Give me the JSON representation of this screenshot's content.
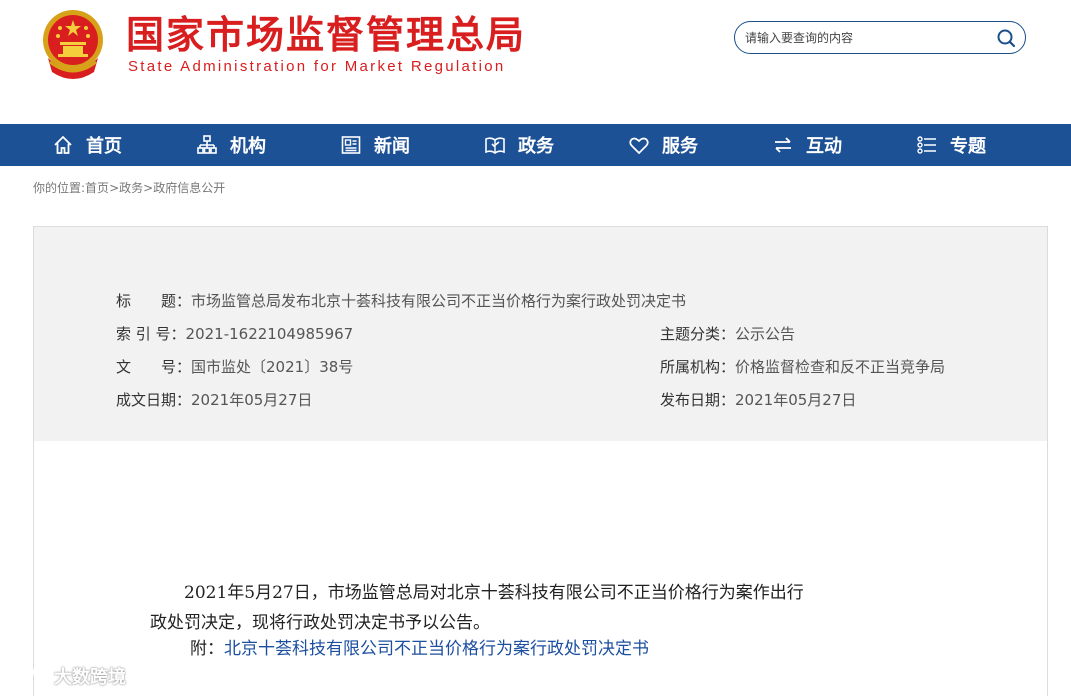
{
  "header": {
    "title": "国家市场监督管理总局",
    "subtitle": "State Administration for Market Regulation",
    "search_placeholder": "请输入要查询的内容"
  },
  "nav": {
    "items": [
      {
        "label": "首页",
        "icon": "home-icon"
      },
      {
        "label": "机构",
        "icon": "org-icon"
      },
      {
        "label": "新闻",
        "icon": "news-icon"
      },
      {
        "label": "政务",
        "icon": "affairs-icon"
      },
      {
        "label": "服务",
        "icon": "heart-icon"
      },
      {
        "label": "互动",
        "icon": "exchange-icon"
      },
      {
        "label": "专题",
        "icon": "topic-icon"
      }
    ]
  },
  "breadcrumb": {
    "prefix": "你的位置:",
    "items": [
      "首页",
      "政务",
      "政府信息公开"
    ],
    "separator": ">"
  },
  "info": {
    "title_label": "标　　题：",
    "title_value": "市场监管总局发布北京十荟科技有限公司不正当价格行为案行政处罚决定书",
    "index_label": "索 引 号：",
    "index_value": "2021-1622104985967",
    "topic_label": "主题分类：",
    "topic_value": "公示公告",
    "docno_label": "文　　号：",
    "docno_value": "国市监处〔2021〕38号",
    "org_label": "所属机构：",
    "org_value": "价格监督检查和反不正当竞争局",
    "created_label": "成文日期：",
    "created_value": "2021年05月27日",
    "published_label": "发布日期：",
    "published_value": "2021年05月27日"
  },
  "content": {
    "para_line1": "　　2021年5月27日，市场监管总局对北京十荟科技有限公司不正当价格行为案作出行",
    "para_line2": "政处罚决定，现将行政处罚决定书予以公告。",
    "attach_prefix": "附：",
    "attach_link": "北京十荟科技有限公司不正当价格行为案行政处罚决定书"
  },
  "watermark": {
    "text": "大数跨境"
  },
  "colors": {
    "brand_red": "#d81e1e",
    "nav_blue": "#1c5196",
    "link_blue": "#1c4fa0",
    "panel_gray": "#f2f2f2"
  }
}
